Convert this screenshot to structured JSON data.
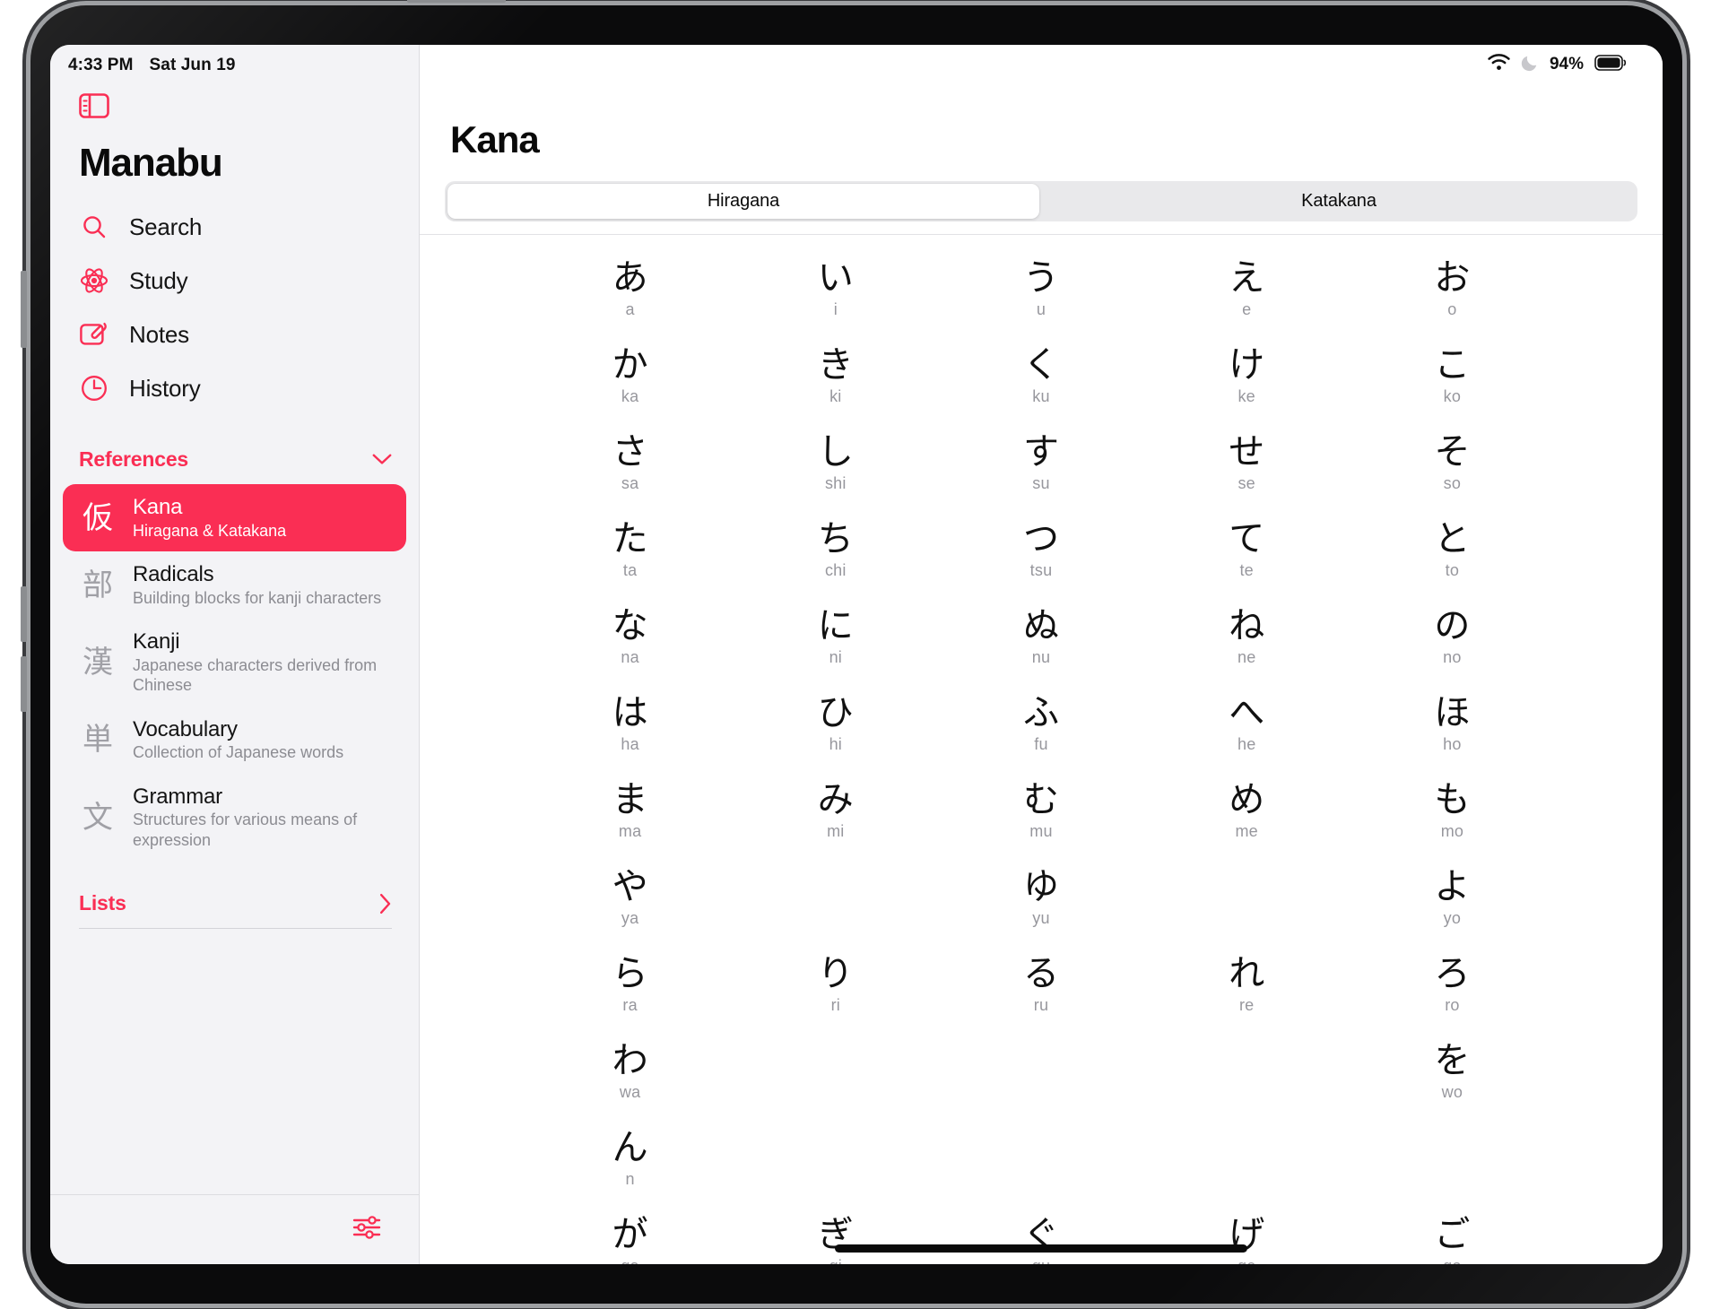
{
  "theme": {
    "accent": "#FA2E54",
    "sidebar_bg": "#F3F3F6",
    "muted_text": "#8C8C92",
    "kana_text": "#111111"
  },
  "status_bar": {
    "time": "4:33 PM",
    "date": "Sat Jun 19",
    "wifi_icon": "wifi-icon",
    "dnd_icon": "moon-icon",
    "battery_percent": "94%",
    "battery_icon": "battery-full-icon"
  },
  "sidebar": {
    "toggle_icon": "sidebar-toggle-icon",
    "app_title": "Manabu",
    "nav_items": [
      {
        "label": "Search",
        "icon": "search-icon"
      },
      {
        "label": "Study",
        "icon": "atom-icon"
      },
      {
        "label": "Notes",
        "icon": "note-paperclip-icon"
      },
      {
        "label": "History",
        "icon": "clock-icon"
      }
    ],
    "references": {
      "title": "References",
      "chevron_icon": "chevron-down-icon",
      "items": [
        {
          "kanji": "仮",
          "name": "Kana",
          "desc": "Hiragana & Katakana",
          "selected": true
        },
        {
          "kanji": "部",
          "name": "Radicals",
          "desc": "Building blocks for kanji characters",
          "selected": false
        },
        {
          "kanji": "漢",
          "name": "Kanji",
          "desc": "Japanese characters derived from Chinese",
          "selected": false
        },
        {
          "kanji": "単",
          "name": "Vocabulary",
          "desc": "Collection of Japanese words",
          "selected": false
        },
        {
          "kanji": "文",
          "name": "Grammar",
          "desc": "Structures for various means of expression",
          "selected": false
        }
      ]
    },
    "lists": {
      "title": "Lists",
      "chevron_icon": "chevron-right-icon"
    },
    "footer_icon": "sliders-settings-icon"
  },
  "detail": {
    "title": "Kana",
    "segmented_control": {
      "options": [
        "Hiragana",
        "Katakana"
      ],
      "selected": "Hiragana"
    },
    "kana_table": {
      "columns": [
        "a",
        "i",
        "u",
        "e",
        "o"
      ],
      "rows": [
        [
          {
            "char": "あ",
            "romaji": "a"
          },
          {
            "char": "い",
            "romaji": "i"
          },
          {
            "char": "う",
            "romaji": "u"
          },
          {
            "char": "え",
            "romaji": "e"
          },
          {
            "char": "お",
            "romaji": "o"
          }
        ],
        [
          {
            "char": "か",
            "romaji": "ka"
          },
          {
            "char": "き",
            "romaji": "ki"
          },
          {
            "char": "く",
            "romaji": "ku"
          },
          {
            "char": "け",
            "romaji": "ke"
          },
          {
            "char": "こ",
            "romaji": "ko"
          }
        ],
        [
          {
            "char": "さ",
            "romaji": "sa"
          },
          {
            "char": "し",
            "romaji": "shi"
          },
          {
            "char": "す",
            "romaji": "su"
          },
          {
            "char": "せ",
            "romaji": "se"
          },
          {
            "char": "そ",
            "romaji": "so"
          }
        ],
        [
          {
            "char": "た",
            "romaji": "ta"
          },
          {
            "char": "ち",
            "romaji": "chi"
          },
          {
            "char": "つ",
            "romaji": "tsu"
          },
          {
            "char": "て",
            "romaji": "te"
          },
          {
            "char": "と",
            "romaji": "to"
          }
        ],
        [
          {
            "char": "な",
            "romaji": "na"
          },
          {
            "char": "に",
            "romaji": "ni"
          },
          {
            "char": "ぬ",
            "romaji": "nu"
          },
          {
            "char": "ね",
            "romaji": "ne"
          },
          {
            "char": "の",
            "romaji": "no"
          }
        ],
        [
          {
            "char": "は",
            "romaji": "ha"
          },
          {
            "char": "ひ",
            "romaji": "hi"
          },
          {
            "char": "ふ",
            "romaji": "fu"
          },
          {
            "char": "へ",
            "romaji": "he"
          },
          {
            "char": "ほ",
            "romaji": "ho"
          }
        ],
        [
          {
            "char": "ま",
            "romaji": "ma"
          },
          {
            "char": "み",
            "romaji": "mi"
          },
          {
            "char": "む",
            "romaji": "mu"
          },
          {
            "char": "め",
            "romaji": "me"
          },
          {
            "char": "も",
            "romaji": "mo"
          }
        ],
        [
          {
            "char": "や",
            "romaji": "ya"
          },
          {
            "char": "",
            "romaji": ""
          },
          {
            "char": "ゆ",
            "romaji": "yu"
          },
          {
            "char": "",
            "romaji": ""
          },
          {
            "char": "よ",
            "romaji": "yo"
          }
        ],
        [
          {
            "char": "ら",
            "romaji": "ra"
          },
          {
            "char": "り",
            "romaji": "ri"
          },
          {
            "char": "る",
            "romaji": "ru"
          },
          {
            "char": "れ",
            "romaji": "re"
          },
          {
            "char": "ろ",
            "romaji": "ro"
          }
        ],
        [
          {
            "char": "わ",
            "romaji": "wa"
          },
          {
            "char": "",
            "romaji": ""
          },
          {
            "char": "",
            "romaji": ""
          },
          {
            "char": "",
            "romaji": ""
          },
          {
            "char": "を",
            "romaji": "wo"
          }
        ],
        [
          {
            "char": "ん",
            "romaji": "n"
          },
          {
            "char": "",
            "romaji": ""
          },
          {
            "char": "",
            "romaji": ""
          },
          {
            "char": "",
            "romaji": ""
          },
          {
            "char": "",
            "romaji": ""
          }
        ],
        [
          {
            "char": "が",
            "romaji": "ga"
          },
          {
            "char": "ぎ",
            "romaji": "gi"
          },
          {
            "char": "ぐ",
            "romaji": "gu"
          },
          {
            "char": "げ",
            "romaji": "ge"
          },
          {
            "char": "ご",
            "romaji": "go"
          }
        ]
      ]
    }
  }
}
